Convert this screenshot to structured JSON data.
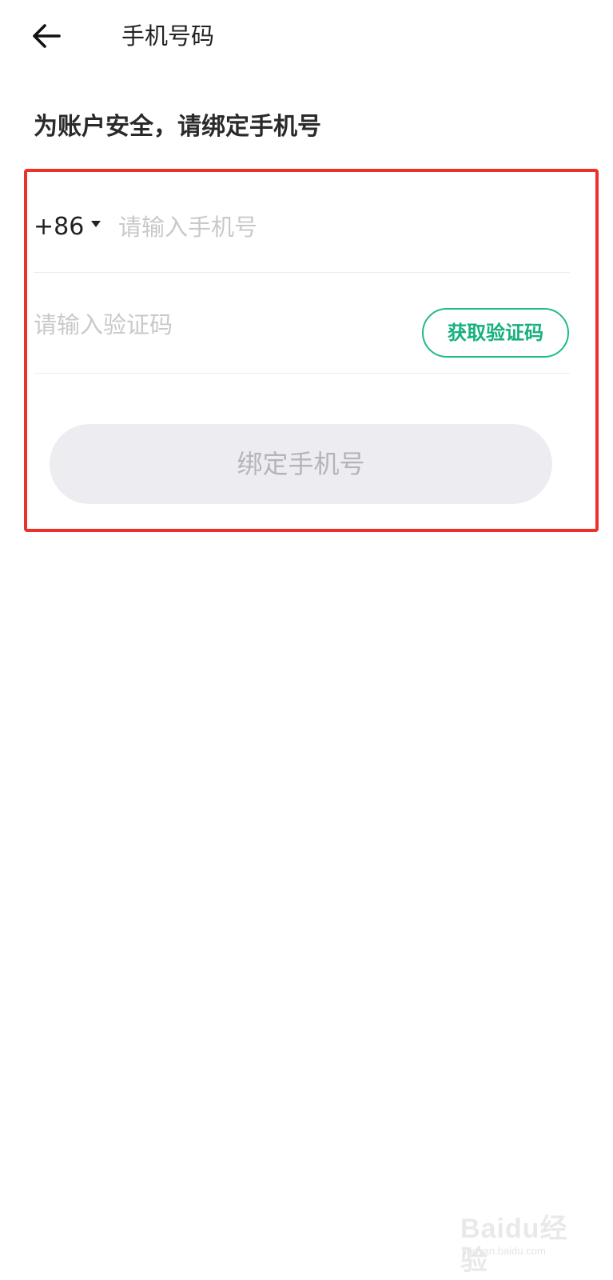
{
  "header": {
    "title": "手机号码",
    "back_icon": "arrow-left-icon"
  },
  "subtitle": "为账户安全，请绑定手机号",
  "form": {
    "country_code": "+86",
    "country_caret_icon": "caret-down-icon",
    "phone_placeholder": "请输入手机号",
    "code_placeholder": "请输入验证码",
    "get_code_label": "获取验证码",
    "submit_label": "绑定手机号"
  },
  "watermark": {
    "main": "Baidu经验",
    "sub": "jingyan.baidu.com"
  },
  "colors": {
    "accent_green": "#17b07f",
    "highlight_red": "#e8322b",
    "disabled_button_bg": "#ededf1",
    "disabled_button_text": "#b4b4bc",
    "placeholder": "#c9c9cc"
  }
}
